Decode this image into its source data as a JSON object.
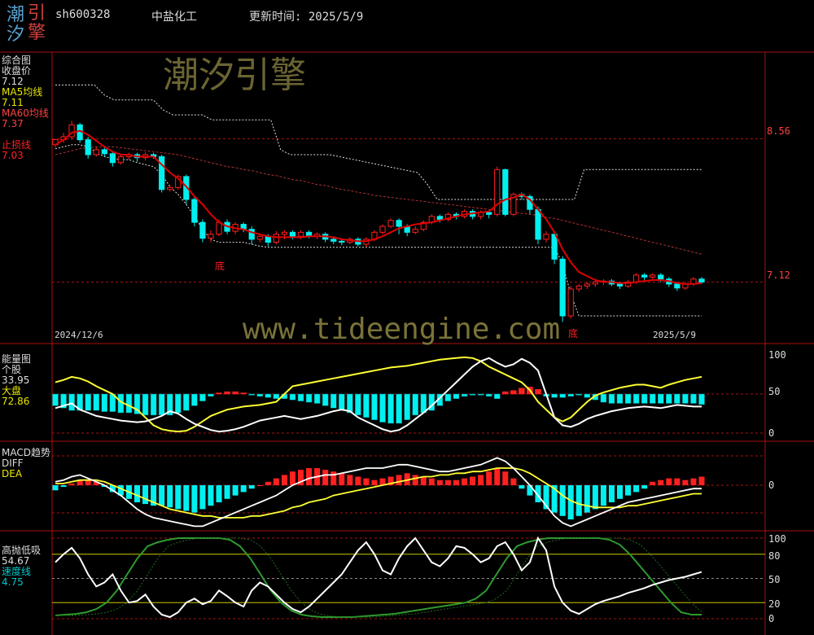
{
  "header": {
    "logo_chars": [
      "潮",
      "引",
      "汐",
      "擎"
    ],
    "code": "sh600328",
    "name": "中盐化工",
    "update_label": "更新时间: 2025/5/9"
  },
  "watermark": {
    "title": "潮汐引擎",
    "url": "www.tideengine.com"
  },
  "colors": {
    "bull": "#ff2020",
    "bear": "#00f0f0",
    "ma5": "#dd0000",
    "ma60": "#b03030",
    "energy_white": "#ffffff",
    "energy_yellow": "#ffff33",
    "speed": "#2e9a2e",
    "grid": "#aa1111",
    "cyan_label": "#00c8c8"
  },
  "panels": {
    "main": {
      "labels": [
        {
          "text": "综合图",
          "color": "#dddddd"
        },
        {
          "text": "收盘价",
          "color": "#dddddd"
        },
        {
          "text": "7.12",
          "color": "#dddddd"
        },
        {
          "text": "MA5均线",
          "color": "#e8e800"
        },
        {
          "text": "7.11",
          "color": "#e8e800"
        },
        {
          "text": "MA60均线",
          "color": "#ff4040"
        },
        {
          "text": "7.37",
          "color": "#ff4040"
        },
        {
          "text": "",
          "color": "#000"
        },
        {
          "text": "止损线",
          "color": "#ff2020"
        },
        {
          "text": "7.03",
          "color": "#ff2020"
        }
      ],
      "axis_labels": [
        "8.56",
        "7.12"
      ],
      "date_start": "2024/12/6",
      "date_end": "2025/5/9",
      "markers": [
        "底",
        "底"
      ]
    },
    "energy": {
      "labels": [
        {
          "text": "能量图",
          "color": "#dddddd"
        },
        {
          "text": "个股",
          "color": "#dddddd"
        },
        {
          "text": "33.95",
          "color": "#dddddd"
        },
        {
          "text": "大盘",
          "color": "#e8e800"
        },
        {
          "text": "72.86",
          "color": "#e8e800"
        }
      ],
      "axis_labels": [
        "100",
        "50",
        "0"
      ]
    },
    "macd": {
      "labels": [
        {
          "text": "MACD趋势",
          "color": "#dddddd"
        },
        {
          "text": "DIFF",
          "color": "#dddddd"
        },
        {
          "text": "DEA",
          "color": "#e8e800"
        }
      ],
      "axis_labels": [
        "0"
      ]
    },
    "gaop": {
      "labels": [
        {
          "text": "高抛低吸",
          "color": "#dddddd"
        },
        {
          "text": "54.67",
          "color": "#dddddd"
        },
        {
          "text": "速度线",
          "color": "#00c8c8"
        },
        {
          "text": "4.75",
          "color": "#00c8c8"
        }
      ],
      "axis_labels": [
        "100",
        "80",
        "50",
        "20",
        "0"
      ]
    }
  },
  "chart_data": {
    "type": "candlestick-composite",
    "date_range": [
      "2024/12/6",
      "2025/5/9"
    ],
    "price_ref_levels": [
      8.56,
      7.12
    ],
    "candles": [
      [
        8.5,
        8.55,
        8.47,
        8.56
      ],
      [
        8.55,
        8.58,
        8.52,
        8.62
      ],
      [
        8.58,
        8.7,
        8.55,
        8.74
      ],
      [
        8.7,
        8.55,
        8.52,
        8.72
      ],
      [
        8.55,
        8.4,
        8.36,
        8.58
      ],
      [
        8.4,
        8.45,
        8.38,
        8.48
      ],
      [
        8.45,
        8.41,
        8.38,
        8.47
      ],
      [
        8.41,
        8.32,
        8.28,
        8.43
      ],
      [
        8.32,
        8.38,
        8.3,
        8.4
      ],
      [
        8.38,
        8.4,
        8.35,
        8.42
      ],
      [
        8.4,
        8.37,
        8.33,
        8.42
      ],
      [
        8.37,
        8.4,
        8.34,
        8.42
      ],
      [
        8.4,
        8.38,
        8.36,
        8.42
      ],
      [
        8.38,
        8.05,
        8.02,
        8.4
      ],
      [
        8.05,
        8.07,
        8.03,
        8.1
      ],
      [
        8.07,
        8.18,
        8.05,
        8.2
      ],
      [
        8.18,
        7.95,
        7.9,
        8.2
      ],
      [
        7.95,
        7.72,
        7.68,
        7.98
      ],
      [
        7.72,
        7.56,
        7.52,
        7.75
      ],
      [
        7.56,
        7.6,
        7.52,
        7.64
      ],
      [
        7.6,
        7.72,
        7.58,
        7.75
      ],
      [
        7.72,
        7.63,
        7.6,
        7.75
      ],
      [
        7.63,
        7.7,
        7.6,
        7.72
      ],
      [
        7.7,
        7.65,
        7.62,
        7.72
      ],
      [
        7.65,
        7.55,
        7.5,
        7.68
      ],
      [
        7.55,
        7.58,
        7.52,
        7.6
      ],
      [
        7.58,
        7.52,
        7.48,
        7.6
      ],
      [
        7.52,
        7.6,
        7.5,
        7.63
      ],
      [
        7.6,
        7.62,
        7.55,
        7.64
      ],
      [
        7.62,
        7.58,
        7.55,
        7.64
      ],
      [
        7.58,
        7.62,
        7.55,
        7.64
      ],
      [
        7.62,
        7.58,
        7.56,
        7.64
      ],
      [
        7.58,
        7.6,
        7.55,
        7.62
      ],
      [
        7.6,
        7.55,
        7.52,
        7.62
      ],
      [
        7.55,
        7.53,
        7.5,
        7.57
      ],
      [
        7.53,
        7.52,
        7.49,
        7.55
      ],
      [
        7.52,
        7.55,
        7.5,
        7.57
      ],
      [
        7.55,
        7.5,
        7.48,
        7.57
      ],
      [
        7.5,
        7.55,
        7.47,
        7.57
      ],
      [
        7.55,
        7.62,
        7.53,
        7.64
      ],
      [
        7.62,
        7.68,
        7.6,
        7.7
      ],
      [
        7.68,
        7.74,
        7.66,
        7.76
      ],
      [
        7.74,
        7.68,
        7.6,
        7.76
      ],
      [
        7.68,
        7.62,
        7.58,
        7.7
      ],
      [
        7.62,
        7.65,
        7.6,
        7.68
      ],
      [
        7.65,
        7.72,
        7.63,
        7.74
      ],
      [
        7.72,
        7.78,
        7.7,
        7.8
      ],
      [
        7.78,
        7.75,
        7.72,
        7.8
      ],
      [
        7.75,
        7.8,
        7.73,
        7.82
      ],
      [
        7.8,
        7.78,
        7.75,
        7.82
      ],
      [
        7.78,
        7.83,
        7.76,
        7.85
      ],
      [
        7.83,
        7.78,
        7.75,
        7.85
      ],
      [
        7.78,
        7.82,
        7.75,
        7.84
      ],
      [
        7.82,
        7.8,
        7.76,
        7.84
      ],
      [
        7.8,
        8.25,
        7.78,
        8.28
      ],
      [
        8.25,
        7.8,
        7.78,
        8.26
      ],
      [
        7.8,
        8.0,
        7.78,
        8.02
      ],
      [
        8.0,
        7.98,
        7.95,
        8.02
      ],
      [
        7.98,
        7.85,
        7.8,
        8.0
      ],
      [
        7.85,
        7.55,
        7.5,
        7.88
      ],
      [
        7.55,
        7.6,
        7.52,
        7.63
      ],
      [
        7.6,
        7.35,
        7.3,
        7.63
      ],
      [
        7.35,
        6.78,
        6.72,
        7.38
      ],
      [
        6.78,
        7.05,
        6.75,
        7.08
      ],
      [
        7.05,
        7.08,
        7.02,
        7.1
      ],
      [
        7.08,
        7.1,
        7.05,
        7.12
      ],
      [
        7.1,
        7.12,
        7.07,
        7.14
      ],
      [
        7.12,
        7.13,
        7.09,
        7.15
      ],
      [
        7.13,
        7.1,
        7.08,
        7.15
      ],
      [
        7.1,
        7.08,
        7.05,
        7.12
      ],
      [
        7.08,
        7.12,
        7.06,
        7.14
      ],
      [
        7.12,
        7.19,
        7.1,
        7.21
      ],
      [
        7.19,
        7.17,
        7.14,
        7.21
      ],
      [
        7.17,
        7.19,
        7.15,
        7.21
      ],
      [
        7.19,
        7.15,
        7.12,
        7.21
      ],
      [
        7.15,
        7.1,
        7.07,
        7.17
      ],
      [
        7.1,
        7.06,
        7.03,
        7.12
      ],
      [
        7.06,
        7.1,
        7.04,
        7.12
      ],
      [
        7.1,
        7.15,
        7.08,
        7.17
      ],
      [
        7.15,
        7.12,
        7.1,
        7.17
      ]
    ],
    "ma5": [
      8.5,
      8.55,
      8.62,
      8.64,
      8.6,
      8.54,
      8.48,
      8.43,
      8.4,
      8.4,
      8.38,
      8.38,
      8.38,
      8.3,
      8.22,
      8.16,
      8.08,
      7.98,
      7.9,
      7.8,
      7.72,
      7.68,
      7.66,
      7.65,
      7.62,
      7.6,
      7.58,
      7.57,
      7.57,
      7.57,
      7.57,
      7.58,
      7.58,
      7.58,
      7.57,
      7.55,
      7.54,
      7.53,
      7.53,
      7.55,
      7.58,
      7.62,
      7.66,
      7.68,
      7.7,
      7.71,
      7.72,
      7.74,
      7.76,
      7.78,
      7.8,
      7.81,
      7.82,
      7.83,
      7.9,
      7.95,
      7.97,
      8.0,
      7.95,
      7.85,
      7.75,
      7.62,
      7.45,
      7.32,
      7.22,
      7.18,
      7.14,
      7.12,
      7.12,
      7.11,
      7.11,
      7.12,
      7.13,
      7.14,
      7.14,
      7.13,
      7.11,
      7.1,
      7.1,
      7.11
    ],
    "ma60": [
      8.4,
      8.42,
      8.44,
      8.46,
      8.47,
      8.48,
      8.48,
      8.48,
      8.47,
      8.46,
      8.45,
      8.44,
      8.43,
      8.42,
      8.41,
      8.4,
      8.38,
      8.36,
      8.34,
      8.32,
      8.3,
      8.28,
      8.27,
      8.25,
      8.24,
      8.22,
      8.2,
      8.19,
      8.17,
      8.15,
      8.14,
      8.12,
      8.1,
      8.09,
      8.07,
      8.05,
      8.04,
      8.02,
      8.01,
      7.99,
      7.98,
      7.97,
      7.96,
      7.95,
      7.94,
      7.93,
      7.92,
      7.91,
      7.9,
      7.89,
      7.88,
      7.87,
      7.86,
      7.85,
      7.84,
      7.83,
      7.82,
      7.81,
      7.8,
      7.79,
      7.77,
      7.76,
      7.74,
      7.72,
      7.7,
      7.68,
      7.66,
      7.64,
      7.62,
      7.6,
      7.58,
      7.56,
      7.54,
      7.52,
      7.5,
      7.48,
      7.46,
      7.44,
      7.42,
      7.4
    ],
    "upper_dotted": [
      9.1,
      9.1,
      9.1,
      9.1,
      9.1,
      9.0,
      8.95,
      8.95,
      8.95,
      8.95,
      8.95,
      8.85,
      8.8,
      8.8,
      8.8,
      8.8,
      8.75,
      8.75,
      8.75,
      8.75,
      8.75,
      8.75,
      8.75,
      8.45,
      8.4,
      8.4,
      8.4,
      8.4,
      8.4,
      8.38,
      8.36,
      8.34,
      8.32,
      8.3,
      8.28,
      8.26,
      8.24,
      8.22,
      8.1,
      7.95,
      7.95,
      7.95,
      7.95,
      7.95,
      7.95,
      7.95,
      7.95,
      7.95,
      7.95,
      7.95,
      7.95,
      7.95,
      7.95,
      7.95,
      8.25,
      8.25,
      8.25,
      8.25,
      8.25,
      8.25,
      8.25,
      8.25,
      8.25,
      8.25,
      8.25,
      8.25,
      8.25
    ],
    "lower_dotted": [
      8.46,
      8.48,
      8.5,
      8.5,
      8.48,
      8.42,
      8.38,
      8.36,
      8.35,
      8.35,
      8.32,
      8.3,
      8.28,
      8.2,
      8.08,
      8.0,
      7.9,
      7.78,
      7.65,
      7.55,
      7.52,
      7.52,
      7.52,
      7.52,
      7.5,
      7.48,
      7.47,
      7.47,
      7.47,
      7.47,
      7.47,
      7.47,
      7.47,
      7.47,
      7.47,
      7.47,
      7.47,
      7.47,
      7.47,
      7.47,
      7.47,
      7.47,
      7.47,
      7.47,
      7.47,
      7.47,
      7.47,
      7.47,
      7.47,
      7.47,
      7.47,
      7.47,
      7.47,
      7.47,
      7.47,
      7.47,
      7.47,
      7.47,
      7.47,
      7.47,
      7.47,
      7.47,
      7.3,
      7.0,
      6.78,
      6.78,
      6.78,
      6.78,
      6.78,
      6.78,
      6.78,
      6.78,
      6.78,
      6.78,
      6.78,
      6.78,
      6.78,
      6.78,
      6.78,
      6.78
    ],
    "energy_stock": [
      32,
      35,
      38,
      30,
      26,
      22,
      20,
      18,
      16,
      15,
      14,
      15,
      18,
      22,
      28,
      25,
      18,
      12,
      8,
      4,
      2,
      3,
      5,
      8,
      12,
      16,
      18,
      20,
      22,
      20,
      18,
      20,
      22,
      25,
      28,
      30,
      28,
      20,
      15,
      10,
      5,
      2,
      4,
      10,
      18,
      26,
      35,
      45,
      55,
      65,
      75,
      85,
      92,
      96,
      90,
      85,
      88,
      95,
      90,
      80,
      50,
      20,
      10,
      8,
      12,
      18,
      22,
      25,
      28,
      30,
      32,
      33,
      34,
      33,
      32,
      34,
      36,
      35,
      34,
      34
    ],
    "energy_market": [
      65,
      68,
      72,
      70,
      66,
      60,
      55,
      50,
      40,
      35,
      30,
      20,
      10,
      5,
      3,
      2,
      3,
      8,
      15,
      22,
      26,
      30,
      32,
      34,
      35,
      36,
      38,
      40,
      50,
      60,
      62,
      64,
      66,
      68,
      70,
      72,
      74,
      76,
      78,
      80,
      82,
      84,
      85,
      86,
      88,
      90,
      92,
      94,
      95,
      96,
      97,
      96,
      92,
      85,
      80,
      75,
      70,
      65,
      55,
      40,
      30,
      20,
      15,
      20,
      30,
      40,
      48,
      52,
      55,
      58,
      60,
      62,
      62,
      60,
      58,
      62,
      65,
      68,
      70,
      72
    ],
    "energy_bar_signed": [
      -10,
      -12,
      -14,
      -14,
      -14,
      -14,
      -15,
      -15,
      -16,
      -16,
      -17,
      -18,
      -18,
      -18,
      -18,
      -16,
      -14,
      -10,
      -6,
      -2,
      1,
      2,
      2,
      1,
      -1,
      -2,
      -3,
      -4,
      -4,
      -5,
      -6,
      -7,
      -8,
      -10,
      -12,
      -14,
      -16,
      -18,
      -20,
      -22,
      -24,
      -25,
      -25,
      -22,
      -18,
      -16,
      -14,
      -10,
      -6,
      -4,
      -2,
      -1,
      -1,
      -2,
      -4,
      2,
      3,
      5,
      6,
      4,
      -2,
      -3,
      -3,
      -2,
      -1,
      -3,
      -5,
      -7,
      -8,
      -8,
      -8,
      -8,
      -8,
      -8,
      -8,
      -8,
      -8,
      -8,
      -8,
      -9
    ],
    "macd_hist": [
      -3,
      -1,
      1,
      3,
      3,
      2,
      -1,
      -4,
      -6,
      -8,
      -10,
      -11,
      -12,
      -12,
      -13,
      -14,
      -15,
      -16,
      -14,
      -12,
      -10,
      -8,
      -6,
      -4,
      -2,
      0,
      2,
      4,
      6,
      8,
      9,
      10,
      10,
      9,
      8,
      7,
      6,
      5,
      4,
      3,
      4,
      5,
      6,
      7,
      6,
      5,
      4,
      3,
      3,
      3,
      4,
      5,
      6,
      8,
      10,
      8,
      4,
      -2,
      -6,
      -10,
      -14,
      -16,
      -18,
      -20,
      -18,
      -16,
      -14,
      -12,
      -10,
      -8,
      -6,
      -4,
      -2,
      2,
      3,
      4,
      4,
      3,
      4,
      5
    ],
    "macd_diff": [
      2,
      3,
      5,
      6,
      4,
      2,
      0,
      -3,
      -6,
      -10,
      -14,
      -17,
      -19,
      -20,
      -21,
      -22,
      -23,
      -24,
      -24,
      -22,
      -20,
      -18,
      -16,
      -14,
      -12,
      -10,
      -8,
      -6,
      -3,
      0,
      2,
      4,
      5,
      6,
      6,
      7,
      8,
      9,
      10,
      10,
      10,
      11,
      12,
      12,
      11,
      10,
      9,
      8,
      8,
      9,
      10,
      11,
      12,
      14,
      16,
      14,
      10,
      5,
      0,
      -6,
      -12,
      -18,
      -22,
      -24,
      -22,
      -20,
      -18,
      -16,
      -14,
      -12,
      -10,
      -9,
      -8,
      -7,
      -6,
      -5,
      -4,
      -3,
      -2,
      -2
    ],
    "macd_dea": [
      1,
      1,
      2,
      3,
      3,
      3,
      2,
      0,
      -2,
      -4,
      -6,
      -8,
      -10,
      -12,
      -14,
      -15,
      -16,
      -17,
      -18,
      -18,
      -19,
      -19,
      -19,
      -19,
      -18,
      -18,
      -17,
      -16,
      -15,
      -13,
      -12,
      -10,
      -9,
      -8,
      -6,
      -5,
      -4,
      -3,
      -2,
      -1,
      0,
      1,
      2,
      3,
      4,
      5,
      5,
      6,
      6,
      7,
      7,
      8,
      8,
      9,
      10,
      10,
      10,
      9,
      7,
      4,
      1,
      -2,
      -6,
      -9,
      -11,
      -12,
      -13,
      -13,
      -13,
      -13,
      -12,
      -12,
      -11,
      -10,
      -9,
      -8,
      -7,
      -6,
      -5,
      -5
    ],
    "gaop_white": [
      70,
      80,
      88,
      75,
      55,
      40,
      45,
      55,
      35,
      20,
      22,
      30,
      15,
      5,
      2,
      8,
      20,
      25,
      18,
      22,
      35,
      28,
      20,
      15,
      35,
      45,
      40,
      30,
      20,
      12,
      8,
      15,
      25,
      35,
      45,
      55,
      70,
      85,
      95,
      80,
      60,
      55,
      75,
      90,
      100,
      85,
      70,
      65,
      75,
      90,
      88,
      80,
      70,
      75,
      90,
      95,
      80,
      60,
      70,
      100,
      85,
      40,
      20,
      10,
      6,
      12,
      18,
      22,
      25,
      28,
      32,
      35,
      38,
      42,
      45,
      48,
      50,
      52,
      55,
      58
    ],
    "gaop_speed": [
      4,
      5,
      6,
      8,
      12,
      20,
      35,
      55,
      75,
      90,
      95,
      98,
      100,
      100,
      100,
      100,
      100,
      98,
      90,
      75,
      55,
      35,
      20,
      10,
      5,
      3,
      2,
      2,
      2,
      2,
      3,
      4,
      5,
      6,
      8,
      10,
      12,
      14,
      16,
      18,
      20,
      25,
      35,
      55,
      75,
      90,
      95,
      98,
      100,
      100,
      100,
      100,
      100,
      100,
      98,
      92,
      80,
      65,
      50,
      35,
      20,
      8,
      5,
      5
    ]
  }
}
